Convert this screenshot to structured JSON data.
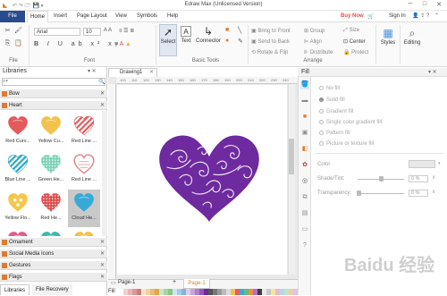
{
  "app": {
    "title": "Edraw Max (Unlicensed Version)",
    "win_min": "─",
    "win_max": "□",
    "win_close": "✕"
  },
  "menu": {
    "file": "File",
    "tabs": [
      "Home",
      "Insert",
      "Page Layout",
      "View",
      "Symbols",
      "Help"
    ],
    "buy_now": "Buy Now",
    "sign_in": "Sign In"
  },
  "ribbon": {
    "font_name": "Arial",
    "font_size": "10",
    "group_file": "File",
    "group_font": "Font",
    "group_basic_tools": "Basic Tools",
    "group_arrange": "Arrange",
    "select_label": "Select",
    "text_label": "Text",
    "connector_label": "Connector",
    "bring_to_front": "Bring to Front",
    "send_to_back": "Send to Back",
    "rotate_flip": "Rotate & Flip",
    "group": "Group",
    "align": "Align",
    "distribute": "Distribute",
    "size": "Size",
    "center": "Center",
    "protect": "Protect",
    "styles": "Styles",
    "editing": "Editing"
  },
  "libraries": {
    "title": "Libraries",
    "categories_top": [
      {
        "label": "Bow"
      },
      {
        "label": "Heart"
      }
    ],
    "hearts": [
      {
        "label": "Red Curv...",
        "color": "#e35b5b",
        "style": "fill"
      },
      {
        "label": "Yellow Cu...",
        "color": "#f2c24d",
        "style": "fill"
      },
      {
        "label": "Red Line ...",
        "color": "#e35b5b",
        "style": "stripes"
      },
      {
        "label": "Blue Line ...",
        "color": "#2aa7c9",
        "style": "stripes"
      },
      {
        "label": "Green He...",
        "color": "#7bd3b7",
        "style": "dots"
      },
      {
        "label": "Red Line ...",
        "color": "#e38a8a",
        "style": "outline"
      },
      {
        "label": "Yellow Flo...",
        "color": "#f5c64d",
        "style": "floral"
      },
      {
        "label": "Red He...",
        "color": "#e04a4a",
        "style": "dots"
      },
      {
        "label": "Cloud He...",
        "color": "#38a9d6",
        "style": "fill"
      },
      {
        "label": "",
        "color": "#e35b8f",
        "style": "fill"
      },
      {
        "label": "",
        "color": "#3fb8ae",
        "style": "fill"
      },
      {
        "label": "",
        "color": "#f2c24d",
        "style": "fill"
      }
    ],
    "categories_bottom": [
      {
        "label": "Ornament"
      },
      {
        "label": "Social Media Icons"
      },
      {
        "label": "Gestures"
      },
      {
        "label": "Flags"
      }
    ],
    "bottom_tabs": [
      "Libraries",
      "File Recovery"
    ]
  },
  "document": {
    "tab": "Drawing1",
    "page_tab": "Page-1",
    "page_active": "Page-1",
    "add_page": "+",
    "ruler_ticks": [
      "100",
      "110",
      "120",
      "130",
      "140",
      "150",
      "160",
      "170",
      "180",
      "190",
      "200",
      "210",
      "220",
      "230",
      "240"
    ],
    "heart_color": "#6e2a9f",
    "fill_label": "Fill"
  },
  "fill_panel": {
    "title": "Fill",
    "options": [
      "No fill",
      "Solid fill",
      "Gradient fill",
      "Single color gradient fill",
      "Pattern fill",
      "Picture or texture fill"
    ],
    "color_label": "Color",
    "shade_label": "Shade/Tint:",
    "shade_value": "0 %",
    "transparency_label": "Transparency:",
    "transparency_value": "0 %"
  },
  "watermark": "Baidu 经验",
  "palette_colors": [
    "#ffffff",
    "#f2d0d0",
    "#e8b3b3",
    "#dd9797",
    "#d37b7b",
    "#f7e5c9",
    "#f1d1a0",
    "#eabb73",
    "#e4a647",
    "#c9e6c6",
    "#a7d8a2",
    "#84c97d",
    "#cfe3f3",
    "#a6cde9",
    "#7db7df",
    "#e0cde9",
    "#c8a6d8",
    "#b07fc8",
    "#9959b8",
    "#6e2a9f",
    "#555555",
    "#777777",
    "#999999",
    "#bbbbbb",
    "#dddddd",
    "#f0c04f",
    "#e85e5e",
    "#47a4d6",
    "#5bbf8a",
    "#f08c3c",
    "#b86ad0",
    "#3d3d3d",
    "#e9e9e9",
    "#c8c8c8",
    "#f4e3a1",
    "#e9b8cb",
    "#b7d7ee",
    "#bfe3cc",
    "#f6caa5",
    "#d9c4ea"
  ]
}
